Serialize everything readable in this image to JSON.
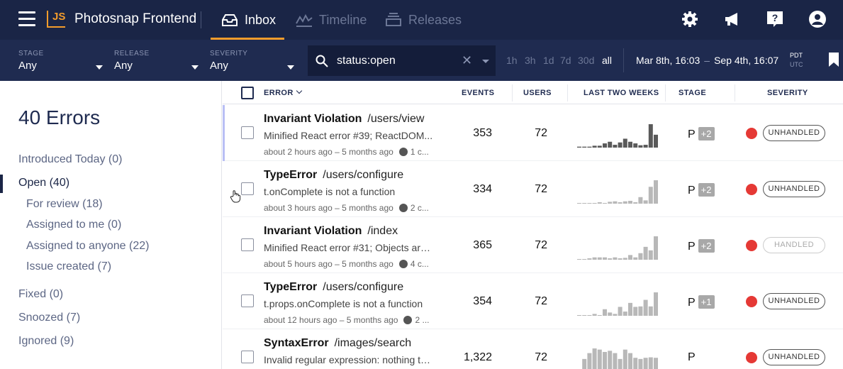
{
  "header": {
    "logo_text": "JS",
    "project_name": "Photosnap Frontend",
    "tabs": [
      {
        "label": "Inbox",
        "active": true,
        "icon": "inbox-icon"
      },
      {
        "label": "Timeline",
        "active": false,
        "icon": "timeline-icon"
      },
      {
        "label": "Releases",
        "active": false,
        "icon": "releases-icon"
      }
    ],
    "right_icons": [
      "gear-icon",
      "megaphone-icon",
      "help-icon",
      "user-icon"
    ]
  },
  "filters": {
    "stage": {
      "label": "STAGE",
      "value": "Any"
    },
    "release": {
      "label": "RELEASE",
      "value": "Any"
    },
    "severity": {
      "label": "SEVERITY",
      "value": "Any"
    },
    "search": {
      "value": "status:open"
    },
    "time_ranges": [
      {
        "label": "1h",
        "active": false
      },
      {
        "label": "3h",
        "active": false
      },
      {
        "label": "1d",
        "active": false
      },
      {
        "label": "7d",
        "active": false
      },
      {
        "label": "30d",
        "active": false
      },
      {
        "label": "all",
        "active": true
      }
    ],
    "date_start": "Mar 8th, 16:03",
    "date_separator": "–",
    "date_end": "Sep 4th, 16:07",
    "timezones": [
      {
        "label": "PDT",
        "selected": true
      },
      {
        "label": "UTC",
        "selected": false
      }
    ]
  },
  "sidebar": {
    "title": "40 Errors",
    "items": [
      {
        "label": "Introduced Today (0)",
        "active": false,
        "indent": false
      },
      {
        "label": "Open (40)",
        "active": true,
        "indent": false
      },
      {
        "label": "For review (18)",
        "active": false,
        "indent": true
      },
      {
        "label": "Assigned to me (0)",
        "active": false,
        "indent": true
      },
      {
        "label": "Assigned to anyone (22)",
        "active": false,
        "indent": true
      },
      {
        "label": "Issue created (7)",
        "active": false,
        "indent": true
      },
      {
        "label": "Fixed (0)",
        "active": false,
        "indent": false
      },
      {
        "label": "Snoozed (7)",
        "active": false,
        "indent": false
      },
      {
        "label": "Ignored (9)",
        "active": false,
        "indent": false
      }
    ]
  },
  "table": {
    "columns": {
      "error": "ERROR",
      "events": "EVENTS",
      "users": "USERS",
      "trend": "LAST TWO WEEKS",
      "stage": "STAGE",
      "severity": "SEVERITY"
    },
    "rows": [
      {
        "type": "Invariant Violation",
        "path": "/users/view",
        "message": "Minified React error #39; ReactDOM...",
        "time": "about 2 hours ago – 5 months ago",
        "users_short": "1 c...",
        "events": "353",
        "users": "72",
        "stage": "P",
        "stage_badge": "+2",
        "severity": "UNHANDLED",
        "handled": false,
        "highlight": true,
        "trend": [
          0.04,
          0.04,
          0.04,
          0.08,
          0.08,
          0.18,
          0.25,
          0.12,
          0.22,
          0.38,
          0.25,
          0.18,
          0.1,
          0.12,
          1.0,
          0.55
        ]
      },
      {
        "type": "TypeError",
        "path": "/users/configure",
        "message": "t.onComplete is not a function",
        "time": "about 3 hours ago – 5 months ago",
        "users_short": "2 c...",
        "events": "334",
        "users": "72",
        "stage": "P",
        "stage_badge": "+2",
        "severity": "UNHANDLED",
        "handled": false,
        "highlight": false,
        "trend": [
          0.03,
          0.03,
          0.03,
          0.03,
          0.06,
          0.03,
          0.08,
          0.1,
          0.06,
          0.1,
          0.12,
          0.06,
          0.28,
          0.14,
          0.72,
          1.0
        ]
      },
      {
        "type": "Invariant Violation",
        "path": "/index",
        "message": "Minified React error #31; Objects are...",
        "time": "about 5 hours ago – 5 months ago",
        "users_short": "4 c...",
        "events": "365",
        "users": "72",
        "stage": "P",
        "stage_badge": "+2",
        "severity": "HANDLED",
        "handled": true,
        "highlight": false,
        "trend": [
          0.03,
          0.03,
          0.06,
          0.1,
          0.1,
          0.1,
          0.06,
          0.1,
          0.06,
          0.08,
          0.2,
          0.1,
          0.28,
          0.55,
          0.4,
          1.0
        ]
      },
      {
        "type": "TypeError",
        "path": "/users/configure",
        "message": "t.props.onComplete is not a function",
        "time": "about 12 hours ago – 5 months ago",
        "users_short": "2 ...",
        "events": "354",
        "users": "72",
        "stage": "P",
        "stage_badge": "+1",
        "severity": "UNHANDLED",
        "handled": false,
        "highlight": false,
        "trend": [
          0.03,
          0.03,
          0.03,
          0.08,
          0.03,
          0.28,
          0.14,
          0.08,
          0.38,
          0.18,
          0.55,
          0.38,
          0.4,
          0.68,
          0.4,
          1.0
        ]
      },
      {
        "type": "SyntaxError",
        "path": "/images/search",
        "message": "Invalid regular expression: nothing to...",
        "time": "",
        "users_short": "",
        "events": "1,322",
        "users": "72",
        "stage": "P",
        "stage_badge": "",
        "severity": "UNHANDLED",
        "handled": false,
        "highlight": false,
        "trend": [
          0.0,
          0.55,
          0.8,
          1.0,
          0.95,
          0.85,
          0.9,
          0.8,
          0.55,
          0.95,
          0.8,
          0.6,
          0.55,
          0.6,
          0.62,
          0.6
        ]
      }
    ]
  }
}
